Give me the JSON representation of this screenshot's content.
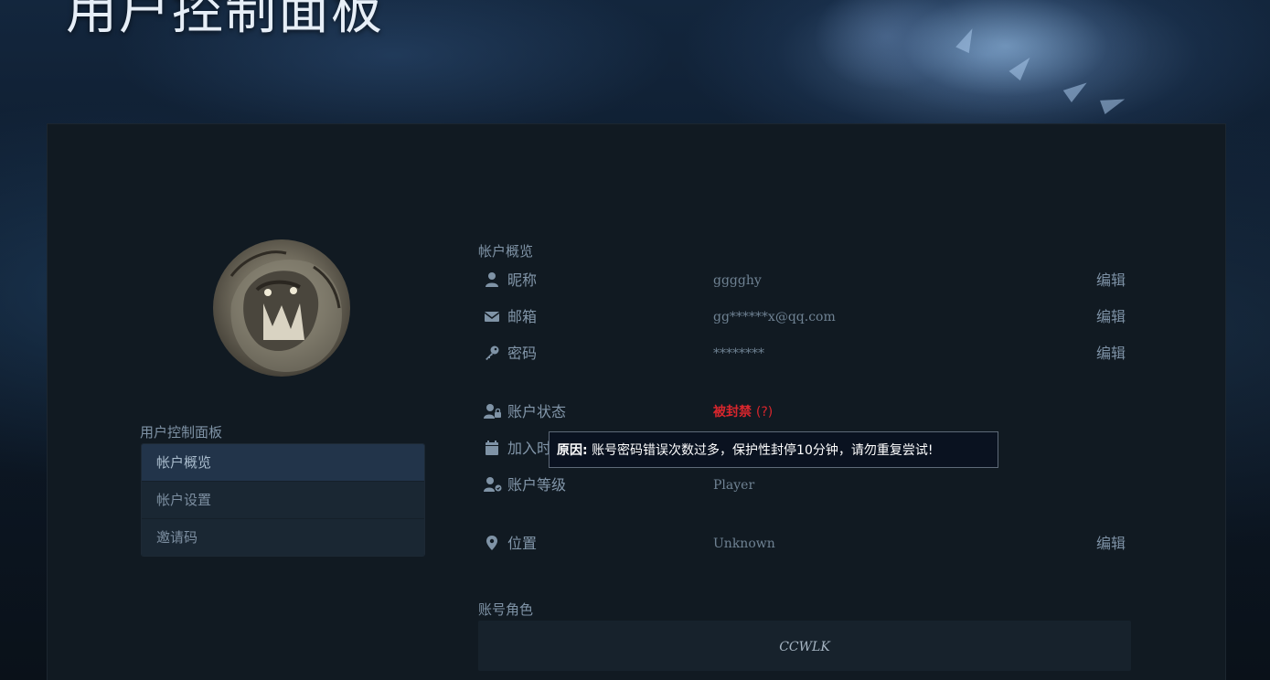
{
  "header": {
    "title": "用户控制面板"
  },
  "sidebar": {
    "title": "用户控制面板",
    "items": [
      {
        "label": "帐户概览",
        "active": true
      },
      {
        "label": "帐户设置",
        "active": false
      },
      {
        "label": "邀请码",
        "active": false
      }
    ]
  },
  "overview": {
    "section_title": "帐户概览",
    "rows": [
      {
        "icon": "user-icon",
        "label": "昵称",
        "value": "gggghy",
        "edit": "编辑"
      },
      {
        "icon": "envelope-icon",
        "label": "邮箱",
        "value": "gg******x@qq.com",
        "edit": "编辑"
      },
      {
        "icon": "key-icon",
        "label": "密码",
        "value": "********",
        "edit": "编辑"
      }
    ],
    "status": {
      "icon": "user-lock-icon",
      "label": "账户状态",
      "value": "被封禁",
      "help": "(?)"
    },
    "joined": {
      "icon": "calendar-icon",
      "label": "加入时"
    },
    "level": {
      "icon": "user-badge-icon",
      "label": "账户等级",
      "value": "Player"
    },
    "location": {
      "icon": "map-pin-icon",
      "label": "位置",
      "value": "Unknown",
      "edit": "编辑"
    }
  },
  "tooltip": {
    "prefix": "原因:",
    "text": "账号密码错误次数过多，保护性封停10分钟，请勿重复尝试!"
  },
  "roles": {
    "section_title": "账号角色",
    "value": "CCWLK"
  },
  "colors": {
    "banned": "#d8262d",
    "panel": "#111a22",
    "active_nav": "#22344a"
  }
}
